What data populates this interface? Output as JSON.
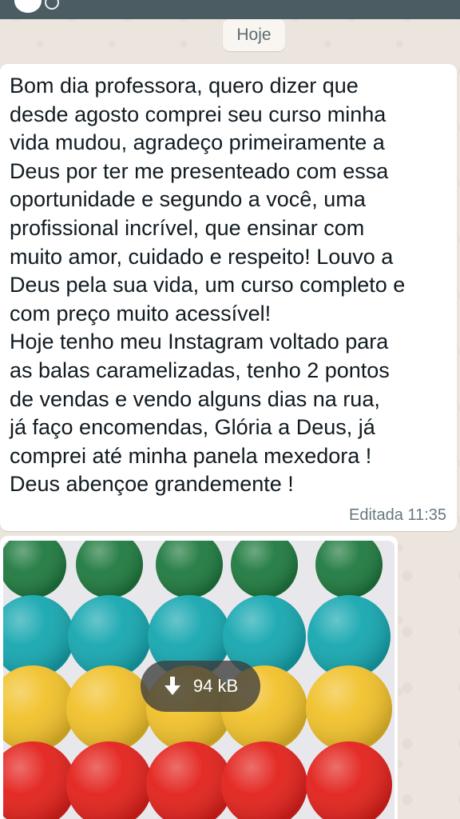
{
  "date_separator": "Hoje",
  "message": {
    "text": "Bom dia professora, quero dizer que\ndesde agosto comprei seu curso minha\nvida mudou, agradeço primeiramente  a\nDeus por ter me presenteado com essa\noportunidade e segundo a você, uma\nprofissional incrível, que ensinar com\nmuito amor, cuidado e respeito! Louvo a\nDeus pela sua vida, um curso completo e\ncom preço muito acessível!\nHoje tenho meu Instagram voltado para\nas balas caramelizadas, tenho 2 pontos\nde vendas e vendo alguns dias na rua,\njá faço encomendas, Glória a Deus, já\ncomprei até minha panela mexedora !\nDeus abençoe grandemente !",
    "edited_label": "Editada",
    "time": "11:35"
  },
  "image_message": {
    "download_size": "94 kB",
    "download_icon": "download-arrow-icon",
    "candy_rows": [
      {
        "color": "#1f7a3f"
      },
      {
        "color": "#16a7b0"
      },
      {
        "color": "#f1c12a"
      },
      {
        "color": "#e3211b"
      }
    ]
  },
  "colors": {
    "topbar": "#4c5c63",
    "chat_background": "#ece5dd",
    "bubble": "#ffffff",
    "meta_text": "#667781"
  }
}
